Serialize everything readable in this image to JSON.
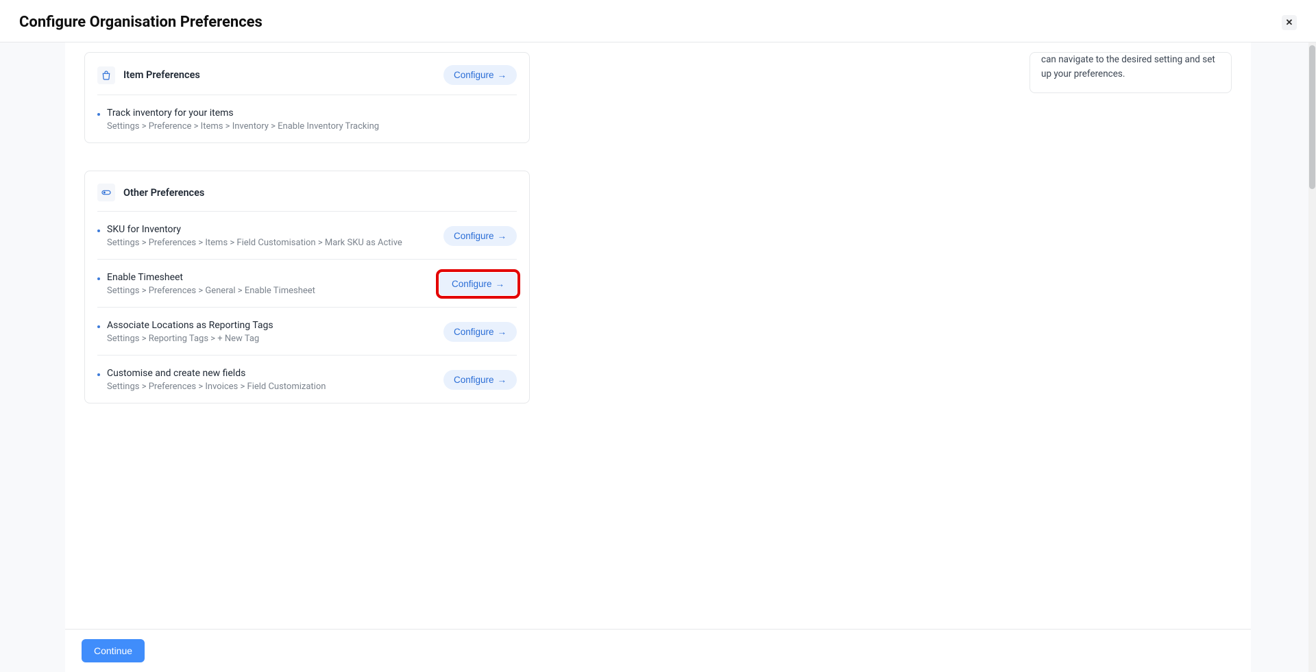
{
  "header": {
    "title": "Configure Organisation Preferences"
  },
  "cards": [
    {
      "title": "Item Preferences",
      "headerConfigure": true,
      "rows": [
        {
          "title": "Track inventory for your items",
          "path": "Settings > Preference > Items > Inventory > Enable Inventory Tracking",
          "configure": false
        }
      ]
    },
    {
      "title": "Other Preferences",
      "headerConfigure": false,
      "rows": [
        {
          "title": "SKU for Inventory",
          "path": "Settings > Preferences > Items > Field Customisation > Mark SKU as Active",
          "configure": true,
          "highlighted": false
        },
        {
          "title": "Enable Timesheet",
          "path": "Settings > Preferences > General > Enable Timesheet",
          "configure": true,
          "highlighted": true
        },
        {
          "title": "Associate Locations as Reporting Tags",
          "path": "Settings > Reporting Tags > + New Tag",
          "configure": true,
          "highlighted": false
        },
        {
          "title": "Customise and create new fields",
          "path": "Settings > Preferences > Invoices > Field Customization",
          "configure": true,
          "highlighted": false
        }
      ]
    }
  ],
  "infoText": "can navigate to the desired setting and set up your preferences.",
  "configureLabel": "Configure",
  "footer": {
    "continue": "Continue"
  }
}
